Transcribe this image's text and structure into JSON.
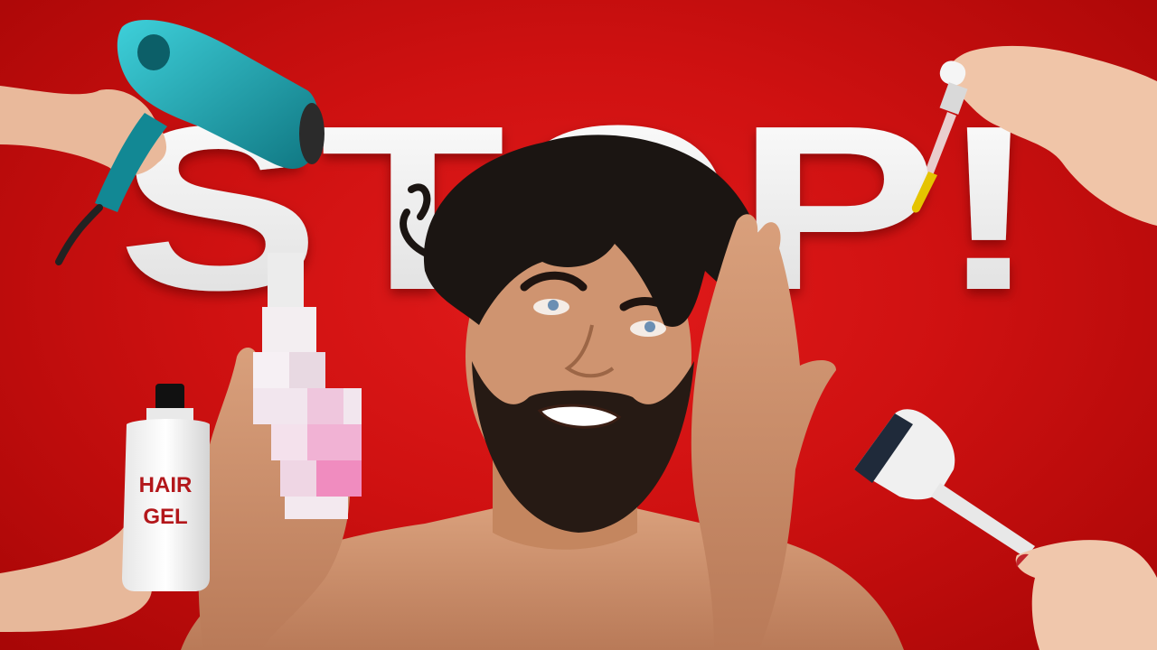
{
  "headline": "STOP!",
  "bottle_label_line1": "HAIR",
  "bottle_label_line2": "GEL",
  "colors": {
    "background": "#d01212",
    "headline": "#f2f2f2",
    "dryer": "#1a9aa6",
    "label_text": "#b3171b",
    "skin": "#c98d6a",
    "hair": "#1b1512"
  },
  "icons": [
    "hair-dryer-icon",
    "dropper-icon",
    "dye-brush-icon",
    "hair-gel-bottle-icon",
    "blurred-bottle-icon"
  ]
}
